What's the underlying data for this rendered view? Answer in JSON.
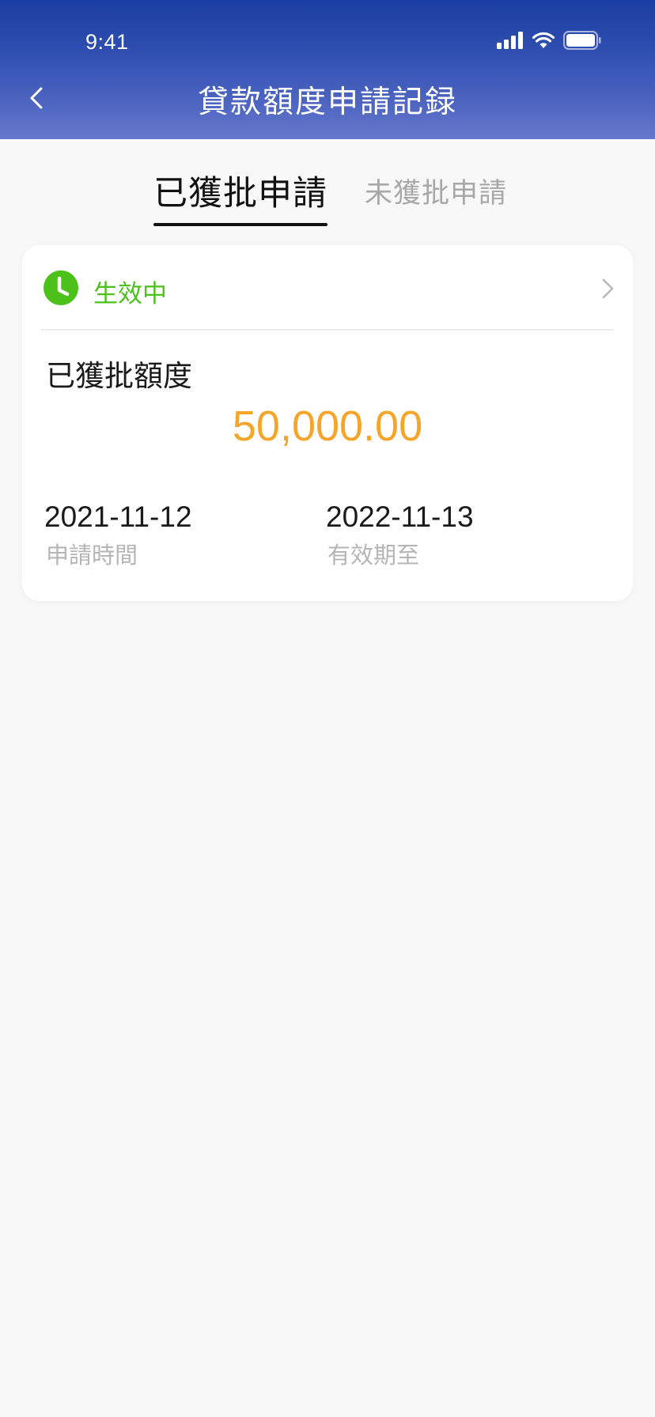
{
  "status_bar": {
    "time": "9:41"
  },
  "nav": {
    "title": "貸款額度申請記録",
    "back_icon": "chevron-left-icon"
  },
  "tabs": [
    {
      "label": "已獲批申請",
      "active": true
    },
    {
      "label": "未獲批申請",
      "active": false
    }
  ],
  "card": {
    "status": "生效中",
    "status_icon": "clock-icon",
    "status_color": "#4cc11a",
    "quota_label": "已獲批額度",
    "quota_amount": "50,000.00",
    "amount_color": "#f5a52a",
    "apply_date": "2021-11-12",
    "apply_date_label": "申請時間",
    "expiry_date": "2022-11-13",
    "expiry_date_label": "有效期至"
  },
  "colors": {
    "header_gradient_top": "#1a3ea3",
    "header_gradient_bottom": "#6477cc",
    "page_background": "#f8f8f8"
  }
}
